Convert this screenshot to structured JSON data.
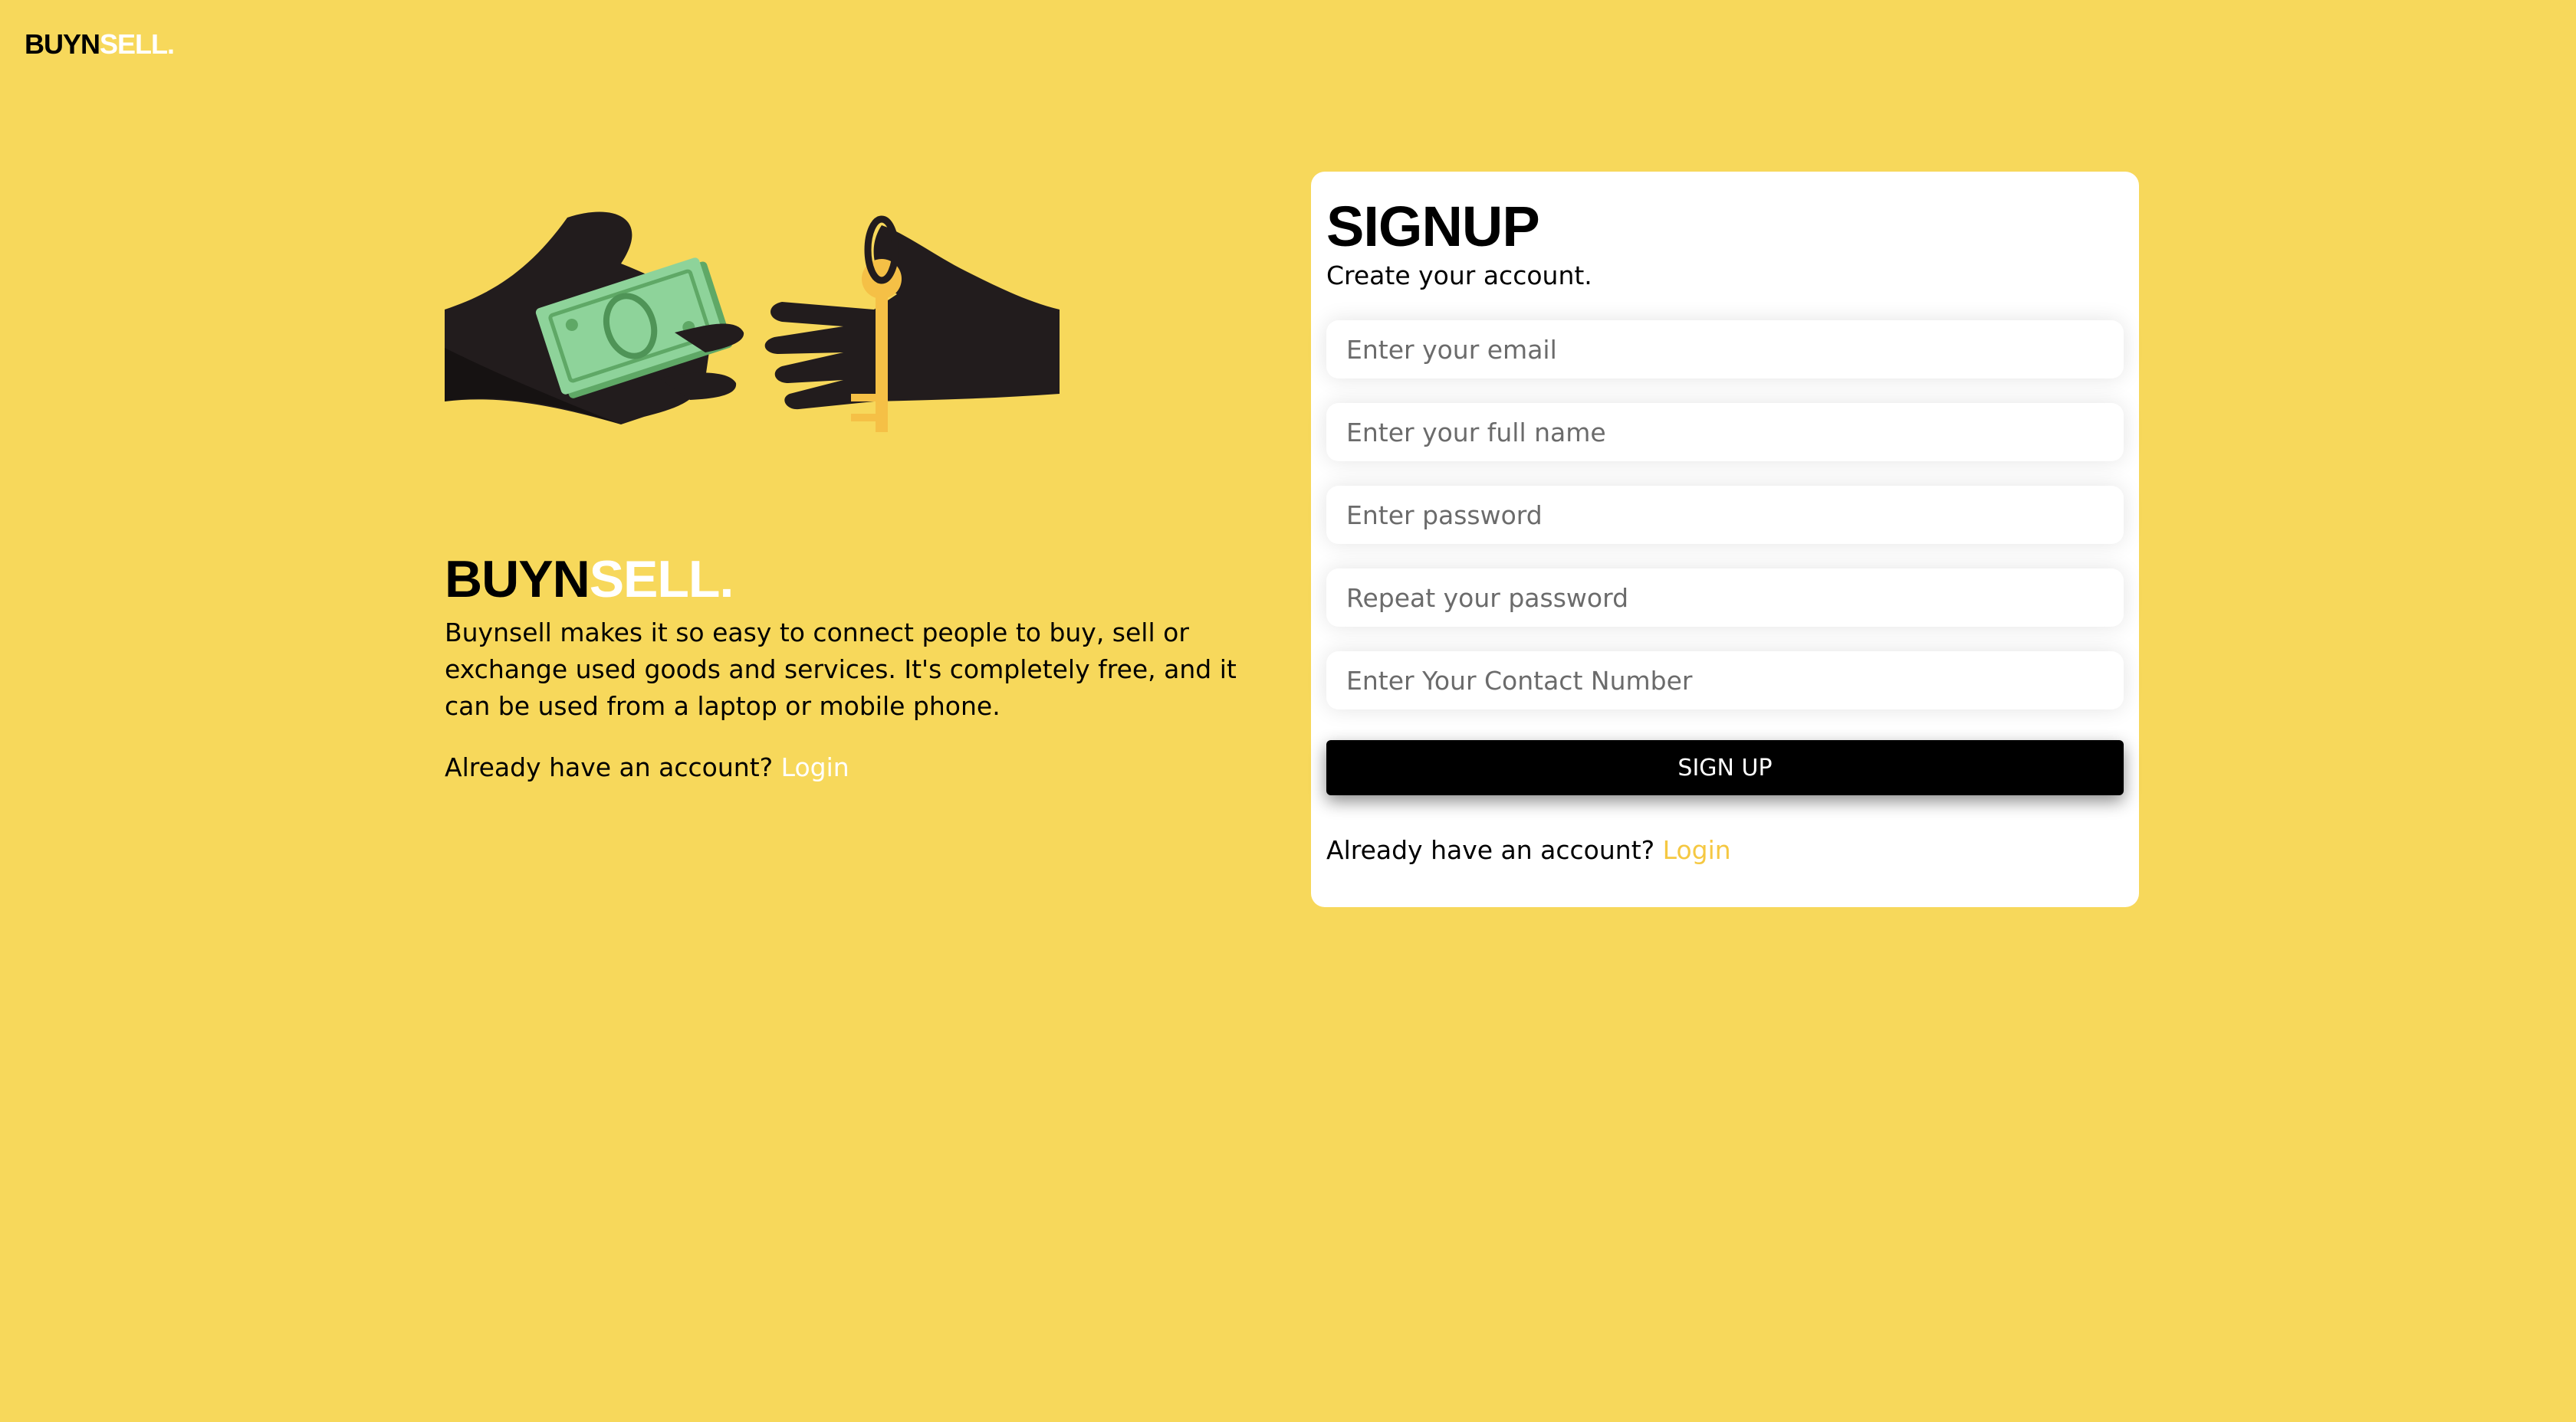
{
  "header": {
    "logo_part1": "BUYN",
    "logo_part2": "SELL."
  },
  "hero": {
    "illustration": "hands-exchanging-money-and-key",
    "brand_part1": "BUYN",
    "brand_part2": "SELL.",
    "description": "Buynsell makes it so easy to connect people to buy, sell or exchange used goods and services. It's completely free, and it can be used from a laptop or mobile phone.",
    "already_text": "Already have an account?",
    "login_label": "Login"
  },
  "form": {
    "title": "SIGNUP",
    "subtitle": "Create your account.",
    "fields": {
      "email": {
        "placeholder": "Enter your email",
        "value": ""
      },
      "full_name": {
        "placeholder": "Enter your full name",
        "value": ""
      },
      "password": {
        "placeholder": "Enter password",
        "value": ""
      },
      "repeat_password": {
        "placeholder": "Repeat your password",
        "value": ""
      },
      "contact": {
        "placeholder": "Enter Your Contact Number",
        "value": ""
      }
    },
    "submit_label": "SIGN UP",
    "already_text": "Already have an account?",
    "login_label": "Login"
  },
  "colors": {
    "background": "#F7D85B",
    "card": "#FFFFFF",
    "button": "#000000",
    "link_on_yellow": "#FFFFFF",
    "link_on_white": "#F5C842"
  }
}
